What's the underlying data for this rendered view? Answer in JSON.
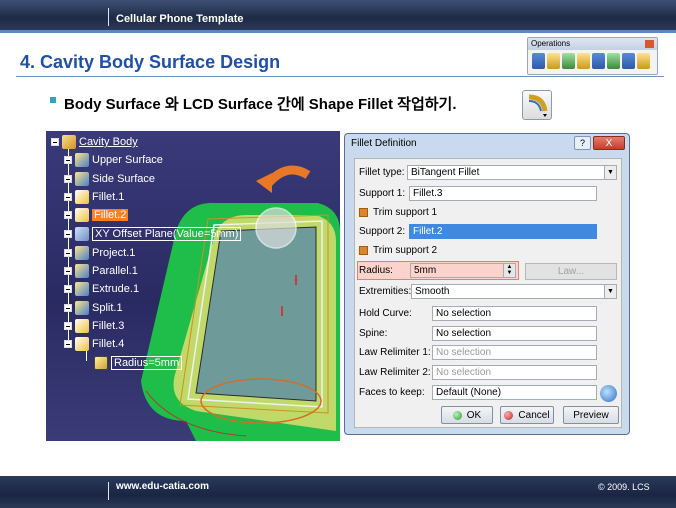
{
  "slide": {
    "header": "Cellular Phone Template",
    "title": "4. Cavity Body Surface Design",
    "bullet": "Body Surface 와 LCD Surface 간에 Shape Fillet 작업하기.",
    "footer_url": "www.edu-catia.com",
    "copyright": "© 2009. LCS"
  },
  "operations_toolbar": {
    "title": "Operations",
    "icons": [
      "join-icon",
      "heal-icon",
      "untrim-icon",
      "disassemble-icon",
      "split-icon",
      "trim-icon",
      "boundary-icon",
      "extract-icon"
    ]
  },
  "shape_fillet_icon": "shape-fillet-icon",
  "tree": {
    "root": "Cavity Body",
    "items": [
      {
        "label": "Upper Surface",
        "icon": "surface-icon"
      },
      {
        "label": "Side Surface",
        "icon": "surface-icon"
      },
      {
        "label": "Fillet.1",
        "icon": "fillet-icon"
      },
      {
        "label": "Fillet.2",
        "icon": "fillet-icon"
      },
      {
        "label": "XY Offset Plane(Value=5mm)",
        "icon": "plane-icon"
      },
      {
        "label": "Project.1",
        "icon": "project-icon"
      },
      {
        "label": "Parallel.1",
        "icon": "parallel-icon"
      },
      {
        "label": "Extrude.1",
        "icon": "extrude-icon"
      },
      {
        "label": "Split.1",
        "icon": "split-icon"
      },
      {
        "label": "Fillet.3",
        "icon": "fillet-icon"
      },
      {
        "label": "Fillet.4",
        "icon": "fillet-icon"
      }
    ],
    "param": "Radius=5mm"
  },
  "dialog": {
    "title": "Fillet Definition",
    "help": "?",
    "close": "X",
    "fillet_type_label": "Fillet type:",
    "fillet_type_value": "BiTangent Fillet",
    "support1_label": "Support 1:",
    "support1_value": "Fillet.3",
    "trim1_label": "Trim support 1",
    "support2_label": "Support 2:",
    "support2_value": "Fillet.2",
    "trim2_label": "Trim support 2",
    "radius_label": "Radius:",
    "radius_value": "5mm",
    "law_label": "Law...",
    "extremities_label": "Extremities:",
    "extremities_value": "Smooth",
    "hold_curve_label": "Hold Curve:",
    "hold_curve_value": "No selection",
    "spine_label": "Spine:",
    "spine_value": "No selection",
    "law_relimiter1_label": "Law Relimiter 1:",
    "law_relimiter1_value": "No selection",
    "law_relimiter2_label": "Law Relimiter 2:",
    "law_relimiter2_value": "No selection",
    "faces_label": "Faces to keep:",
    "faces_value": "Default (None)",
    "ok": "OK",
    "cancel": "Cancel",
    "preview": "Preview"
  }
}
